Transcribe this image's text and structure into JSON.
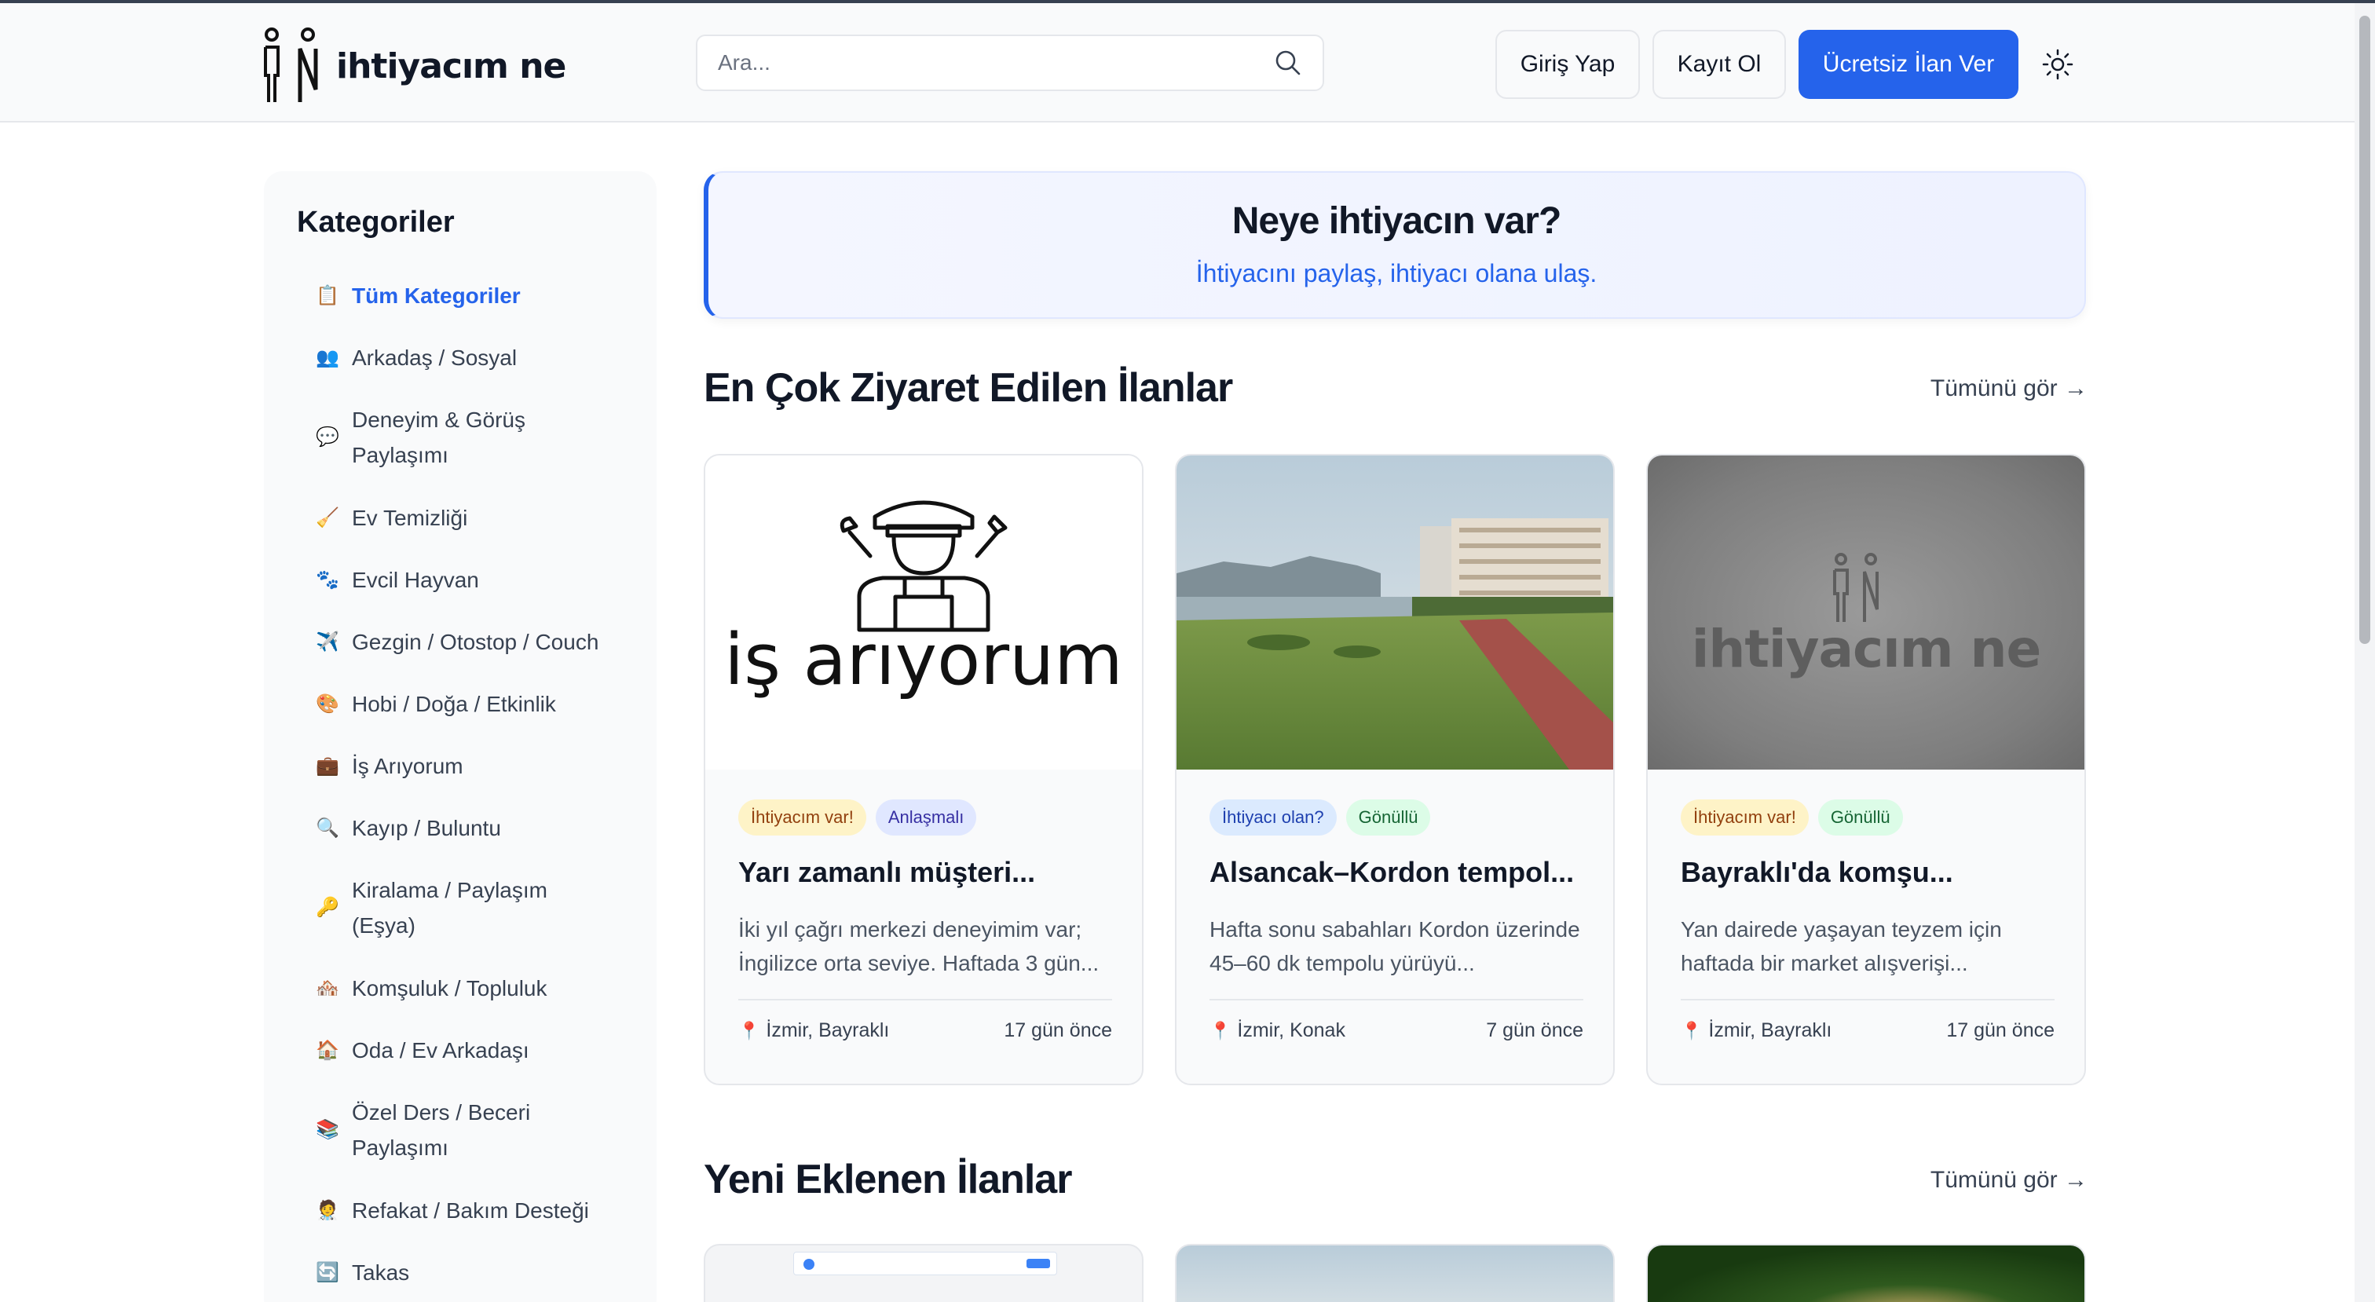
{
  "header": {
    "logo_text": "ihtiyacım ne",
    "search_placeholder": "Ara...",
    "login_label": "Giriş Yap",
    "register_label": "Kayıt Ol",
    "cta_label": "Ücretsiz İlan Ver",
    "theme_icon": "sun-icon",
    "accent_color": "#2563eb"
  },
  "sidebar": {
    "title": "Kategoriler",
    "items": [
      {
        "icon": "📋",
        "label": "Tüm Kategoriler",
        "active": true
      },
      {
        "icon": "👥",
        "label": "Arkadaş / Sosyal"
      },
      {
        "icon": "💬",
        "label": "Deneyim & Görüş Paylaşımı"
      },
      {
        "icon": "🧹",
        "label": "Ev Temizliği"
      },
      {
        "icon": "🐾",
        "label": "Evcil Hayvan"
      },
      {
        "icon": "✈️",
        "label": "Gezgin / Otostop / Couch"
      },
      {
        "icon": "🎨",
        "label": "Hobi / Doğa / Etkinlik"
      },
      {
        "icon": "💼",
        "label": "İş Arıyorum"
      },
      {
        "icon": "🔍",
        "label": "Kayıp / Buluntu"
      },
      {
        "icon": "🔑",
        "label": "Kiralama / Paylaşım (Eşya)"
      },
      {
        "icon": "🏘️",
        "label": "Komşuluk / Topluluk"
      },
      {
        "icon": "🏠",
        "label": "Oda / Ev Arkadaşı"
      },
      {
        "icon": "📚",
        "label": "Özel Ders / Beceri Paylaşımı"
      },
      {
        "icon": "🧑‍⚕️",
        "label": "Refakat / Bakım Desteği"
      },
      {
        "icon": "🔄",
        "label": "Takas"
      }
    ]
  },
  "hero": {
    "title": "Neye ihtiyacın var?",
    "subtitle": "İhtiyacını paylaş, ihtiyacı olana ulaş."
  },
  "sections": {
    "popular": {
      "title": "En Çok Ziyaret Edilen İlanlar",
      "see_all": "Tümünü gör →"
    },
    "new": {
      "title": "Yeni Eklenen İlanlar",
      "see_all": "Tümünü gör →"
    }
  },
  "cards": [
    {
      "image_text": "iş arıyorum",
      "badges": [
        "İhtiyacım var!",
        "Anlaşmalı"
      ],
      "title": "Yarı zamanlı müşteri...",
      "description": "İki yıl çağrı merkezi deneyimim var; İngilizce orta seviye. Haftada 3 gün...",
      "location": "İzmir, Bayraklı",
      "time": "17 gün önce"
    },
    {
      "image_text": "",
      "badges": [
        "İhtiyacı olan?",
        "Gönüllü"
      ],
      "title": "Alsancak–Kordon tempol...",
      "description": "Hafta sonu sabahları Kordon üzerinde 45–60 dk tempolu yürüyü...",
      "location": "İzmir, Konak",
      "time": "7 gün önce"
    },
    {
      "image_text": "ihtiyacım ne",
      "badges": [
        "İhtiyacım var!",
        "Gönüllü"
      ],
      "title": "Bayraklı'da komşu...",
      "description": "Yan dairede yaşayan teyzem için haftada bir market alışverişi...",
      "location": "İzmir, Bayraklı",
      "time": "17 gün önce"
    }
  ]
}
